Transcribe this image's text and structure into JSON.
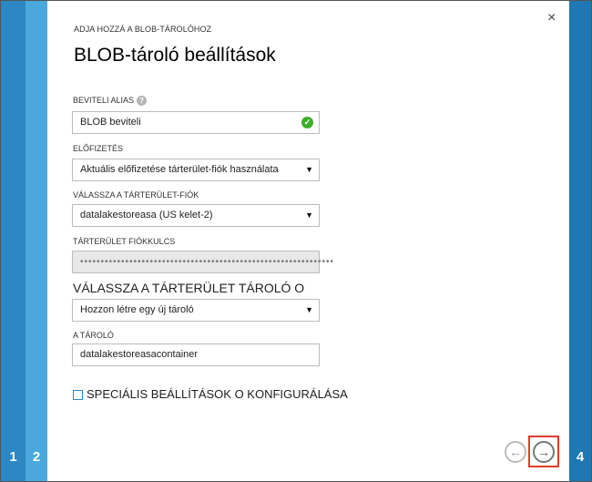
{
  "wizard": {
    "subtitle": "ADJA HOZZÁ A BLOB-TÁROLÓHOZ",
    "title": "BLOB-tároló beállítások",
    "close_icon": "×"
  },
  "steps": [
    {
      "number": "1"
    },
    {
      "number": "2"
    },
    {
      "number": "4"
    }
  ],
  "form": {
    "input_alias": {
      "label": "BEVITELI ALIAS",
      "value": "BLOB beviteli",
      "help_icon": "?",
      "valid_icon": "✓"
    },
    "subscription": {
      "label": "ELŐFIZETÉS",
      "value": "Aktuális előfizetése tárterület-fiók használata",
      "arrow": "▼"
    },
    "storage_account": {
      "label": "VÁLASSZA A TÁRTERÜLET-FIÓK",
      "value": "datalakestoreasa (US kelet-2)",
      "arrow": "▼"
    },
    "storage_key": {
      "label": "TÁRTERÜLET FIÓKKULCS",
      "value": "••••••••••••••••••••••••••••••••••••••••••••••••••••••••••••••"
    },
    "container_choice": {
      "label": "VÁLASSZA A TÁRTERÜLET TÁROLÓ O",
      "value": "Hozzon létre egy új tároló",
      "arrow": "▼"
    },
    "container": {
      "label": "A TÁROLÓ",
      "value": "datalakestoreasacontainer"
    },
    "advanced": {
      "label": "SPECIÁLIS BEÁLLÍTÁSOK O KONFIGURÁLÁSA"
    }
  },
  "nav": {
    "back_icon": "←",
    "next_icon": "→"
  }
}
